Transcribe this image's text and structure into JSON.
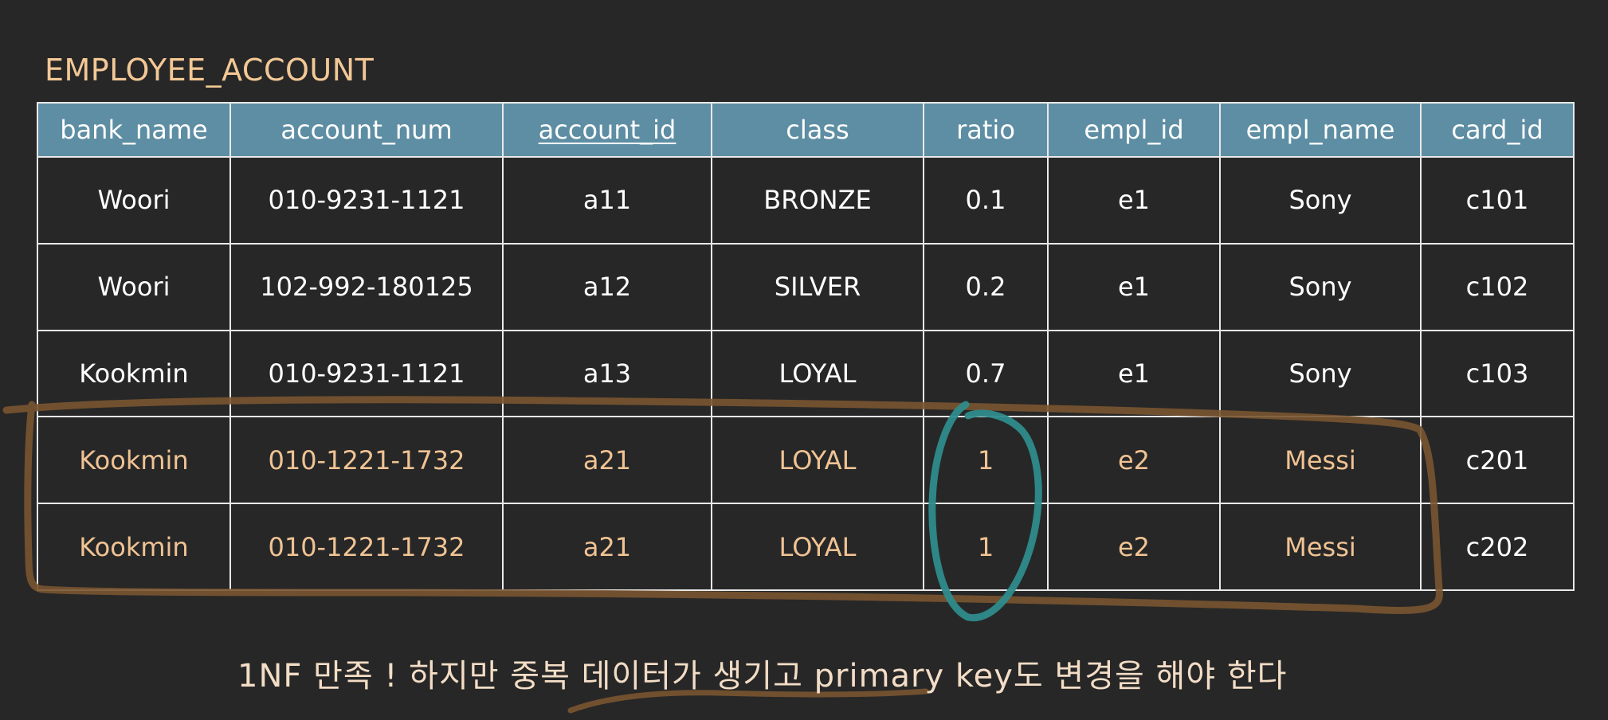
{
  "title": "EMPLOYEE_ACCOUNT",
  "columns": [
    {
      "label": "bank_name",
      "key": false
    },
    {
      "label": "account_num",
      "key": false
    },
    {
      "label": "account_id",
      "key": true
    },
    {
      "label": "class",
      "key": false
    },
    {
      "label": "ratio",
      "key": false
    },
    {
      "label": "empl_id",
      "key": false
    },
    {
      "label": "empl_name",
      "key": false
    },
    {
      "label": "card_id",
      "key": false
    }
  ],
  "rows": [
    {
      "highlight": false,
      "cells": [
        "Woori",
        "010-9231-1121",
        "a11",
        "BRONZE",
        "0.1",
        "e1",
        "Sony",
        "c101"
      ]
    },
    {
      "highlight": false,
      "cells": [
        "Woori",
        "102-992-180125",
        "a12",
        "SILVER",
        "0.2",
        "e1",
        "Sony",
        "c102"
      ]
    },
    {
      "highlight": false,
      "cells": [
        "Kookmin",
        "010-9231-1121",
        "a13",
        "LOYAL",
        "0.7",
        "e1",
        "Sony",
        "c103"
      ]
    },
    {
      "highlight": true,
      "cells": [
        "Kookmin",
        "010-1221-1732",
        "a21",
        "LOYAL",
        "1",
        "e2",
        "Messi",
        "c201"
      ]
    },
    {
      "highlight": true,
      "cells": [
        "Kookmin",
        "010-1221-1732",
        "a21",
        "LOYAL",
        "1",
        "e2",
        "Messi",
        "c202"
      ]
    }
  ],
  "caption": "1NF 만족 ! 하지만 중복 데이터가 생기고 primary key도 변경을 해야 한다",
  "colors": {
    "background": "#272727",
    "header_bg": "#5e8ea3",
    "title": "#f3c896",
    "highlight_text": "#f0c394",
    "brown_marker": "#7a5531",
    "teal_marker": "#2e8b8b"
  }
}
